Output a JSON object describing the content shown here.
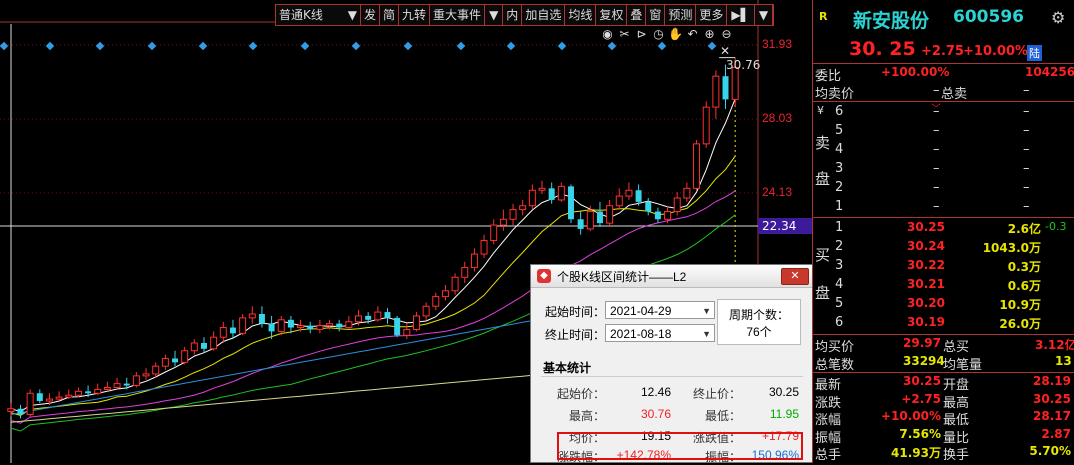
{
  "toolbar": {
    "kline_type": "普通K线",
    "buttons": [
      "发",
      "简",
      "九转",
      "重大事件",
      "内",
      "加自选",
      "均线",
      "复权",
      "叠",
      "窗",
      "预测",
      "更多"
    ]
  },
  "chart": {
    "price_labels": [
      "31.93",
      "28.03",
      "24.13",
      "22.34"
    ],
    "current_price_tag": "22.34",
    "max_marker": "30.76"
  },
  "popup": {
    "title": "个股K线区间统计——L2",
    "close_label": "✕",
    "start_label": "起始时间：",
    "start_value": "2021-04-29",
    "end_label": "终止时间：",
    "end_value": "2021-08-18",
    "period_label": "周期个数：",
    "period_value": "76个",
    "section": "基本统计",
    "stats": {
      "start_price_label": "起始价：",
      "start_price": "12.46",
      "end_price_label": "终止价：",
      "end_price": "30.25",
      "high_label": "最高：",
      "high": "30.76",
      "low_label": "最低：",
      "low": "11.95",
      "avg_label": "均价：",
      "avg": "19.15",
      "change_label": "涨跌值：",
      "change": "+17.79",
      "pct_label": "涨跌幅：",
      "pct": "+142.78%",
      "amp_label": "振幅：",
      "amp": "150.96%"
    }
  },
  "quote": {
    "r_badge": "R",
    "name": "新安股份",
    "code": "600596",
    "price": "30. 25",
    "change": "+2.75",
    "pct": "+10.00%",
    "tag": "陆",
    "weibi_label": "委比",
    "weibi": "+100.00%",
    "weibi_vol": "104256",
    "avg_sell_label": "均卖价",
    "avg_sell": "–",
    "total_sell_label": "总卖",
    "total_sell": "–",
    "sell_side_labels": [
      "¥",
      "卖",
      "盘"
    ],
    "buy_side_labels": [
      "买",
      "盘"
    ],
    "sells": [
      {
        "n": "6",
        "p": "–",
        "v": "–"
      },
      {
        "n": "5",
        "p": "–",
        "v": "–"
      },
      {
        "n": "4",
        "p": "–",
        "v": "–"
      },
      {
        "n": "3",
        "p": "–",
        "v": "–"
      },
      {
        "n": "2",
        "p": "–",
        "v": "–"
      },
      {
        "n": "1",
        "p": "–",
        "v": "–"
      }
    ],
    "buys": [
      {
        "n": "1",
        "p": "30.25",
        "v": "2.6亿",
        "x": "-0.3"
      },
      {
        "n": "2",
        "p": "30.24",
        "v": "1043.0万",
        "x": ""
      },
      {
        "n": "3",
        "p": "30.22",
        "v": "0.3万",
        "x": ""
      },
      {
        "n": "4",
        "p": "30.21",
        "v": "0.6万",
        "x": ""
      },
      {
        "n": "5",
        "p": "30.20",
        "v": "10.9万",
        "x": ""
      },
      {
        "n": "6",
        "p": "30.19",
        "v": "26.0万",
        "x": ""
      }
    ],
    "avg_buy_label": "均买价",
    "avg_buy": "29.97",
    "total_buy_label": "总买",
    "total_buy": "3.12亿",
    "total_trades_label": "总笔数",
    "total_trades": "33294",
    "avg_vol_label": "均笔量",
    "avg_vol": "13",
    "stats": [
      {
        "l1": "最新",
        "v1": "30.25",
        "c1": "red",
        "l2": "开盘",
        "v2": "28.19",
        "c2": "red"
      },
      {
        "l1": "涨跌",
        "v1": "+2.75",
        "c1": "red",
        "l2": "最高",
        "v2": "30.25",
        "c2": "red"
      },
      {
        "l1": "涨幅",
        "v1": "+10.00%",
        "c1": "red",
        "l2": "最低",
        "v2": "28.17",
        "c2": "red"
      },
      {
        "l1": "振幅",
        "v1": "7.56%",
        "c1": "yel",
        "l2": "量比",
        "v2": "2.87",
        "c2": "red"
      },
      {
        "l1": "总手",
        "v1": "41.93万",
        "c1": "yel",
        "l2": "换手",
        "v2": "5.70%",
        "c2": "yel"
      }
    ]
  },
  "chart_data": {
    "type": "candlestick",
    "candles": [
      [
        12.46,
        12.6,
        12.9,
        12.2
      ],
      [
        12.6,
        12.3,
        12.8,
        12.1
      ],
      [
        12.3,
        13.4,
        13.6,
        12.2
      ],
      [
        13.4,
        13.0,
        13.6,
        12.9
      ],
      [
        13.0,
        13.1,
        13.4,
        12.8
      ],
      [
        13.1,
        13.2,
        13.5,
        13.0
      ],
      [
        13.2,
        13.3,
        13.6,
        13.1
      ],
      [
        13.3,
        13.5,
        13.7,
        13.2
      ],
      [
        13.5,
        13.4,
        13.8,
        13.2
      ],
      [
        13.4,
        13.6,
        13.9,
        13.3
      ],
      [
        13.6,
        13.7,
        14.0,
        13.5
      ],
      [
        13.7,
        13.9,
        14.2,
        13.6
      ],
      [
        13.9,
        13.8,
        14.2,
        13.6
      ],
      [
        13.8,
        14.3,
        14.5,
        13.7
      ],
      [
        14.3,
        14.4,
        14.7,
        14.1
      ],
      [
        14.4,
        14.8,
        15.0,
        14.2
      ],
      [
        14.8,
        15.2,
        15.4,
        14.6
      ],
      [
        15.2,
        15.0,
        15.6,
        14.8
      ],
      [
        15.0,
        15.6,
        15.8,
        14.9
      ],
      [
        15.6,
        16.0,
        16.2,
        15.4
      ],
      [
        16.0,
        15.7,
        16.3,
        15.5
      ],
      [
        15.7,
        16.3,
        16.6,
        15.6
      ],
      [
        16.3,
        16.8,
        17.1,
        16.0
      ],
      [
        16.8,
        16.5,
        17.2,
        16.2
      ],
      [
        16.5,
        17.3,
        17.5,
        16.4
      ],
      [
        17.3,
        17.5,
        17.9,
        17.0
      ],
      [
        17.5,
        17.0,
        17.9,
        16.8
      ],
      [
        17.0,
        16.6,
        17.4,
        16.2
      ],
      [
        16.6,
        17.2,
        17.4,
        16.4
      ],
      [
        17.2,
        16.8,
        17.4,
        16.5
      ],
      [
        16.8,
        16.9,
        17.2,
        16.6
      ],
      [
        16.9,
        16.7,
        17.1,
        16.5
      ],
      [
        16.7,
        16.9,
        17.2,
        16.5
      ],
      [
        16.9,
        17.0,
        17.2,
        16.7
      ],
      [
        17.0,
        16.8,
        17.2,
        16.6
      ],
      [
        16.8,
        17.1,
        17.4,
        16.7
      ],
      [
        17.1,
        17.4,
        17.7,
        16.9
      ],
      [
        17.4,
        17.2,
        17.6,
        17.0
      ],
      [
        17.2,
        17.6,
        17.9,
        17.1
      ],
      [
        17.6,
        17.3,
        17.8,
        17.0
      ],
      [
        17.3,
        16.4,
        17.4,
        16.3
      ],
      [
        16.4,
        16.7,
        17.0,
        16.2
      ],
      [
        16.7,
        17.4,
        17.6,
        16.6
      ],
      [
        17.4,
        17.9,
        18.1,
        17.2
      ],
      [
        17.9,
        18.4,
        18.6,
        17.7
      ],
      [
        18.4,
        18.7,
        19.0,
        18.2
      ],
      [
        18.7,
        19.4,
        19.6,
        18.5
      ],
      [
        19.4,
        19.9,
        20.2,
        19.1
      ],
      [
        19.9,
        20.6,
        20.9,
        19.7
      ],
      [
        20.6,
        21.3,
        21.6,
        20.4
      ],
      [
        21.3,
        22.1,
        22.4,
        21.1
      ],
      [
        22.1,
        22.4,
        22.9,
        21.8
      ],
      [
        22.4,
        22.9,
        23.2,
        22.1
      ],
      [
        22.9,
        23.1,
        23.4,
        22.6
      ],
      [
        23.1,
        23.9,
        24.2,
        22.9
      ],
      [
        23.9,
        24.0,
        24.4,
        23.7
      ],
      [
        24.0,
        23.4,
        24.3,
        23.2
      ],
      [
        23.4,
        24.1,
        24.3,
        23.3
      ],
      [
        24.1,
        22.4,
        24.2,
        22.2
      ],
      [
        22.4,
        21.9,
        22.8,
        21.6
      ],
      [
        21.9,
        22.8,
        23.1,
        21.8
      ],
      [
        22.8,
        22.2,
        23.3,
        22.0
      ],
      [
        22.2,
        23.1,
        23.4,
        22.0
      ],
      [
        23.1,
        23.6,
        24.0,
        22.9
      ],
      [
        23.6,
        23.9,
        24.3,
        23.4
      ],
      [
        23.9,
        23.3,
        24.2,
        23.1
      ],
      [
        23.3,
        22.8,
        23.5,
        22.6
      ],
      [
        22.8,
        22.4,
        23.0,
        22.2
      ],
      [
        22.4,
        22.8,
        23.1,
        22.2
      ],
      [
        22.8,
        23.5,
        23.8,
        22.6
      ],
      [
        23.5,
        24.0,
        24.3,
        23.3
      ],
      [
        24.0,
        26.3,
        26.5,
        23.9
      ],
      [
        26.3,
        28.2,
        28.5,
        26.1
      ],
      [
        28.2,
        29.8,
        30.1,
        27.6
      ],
      [
        29.8,
        28.6,
        30.4,
        28.1
      ],
      [
        28.6,
        30.25,
        30.76,
        28.2
      ]
    ],
    "ylim": [
      11.5,
      32.5
    ]
  }
}
